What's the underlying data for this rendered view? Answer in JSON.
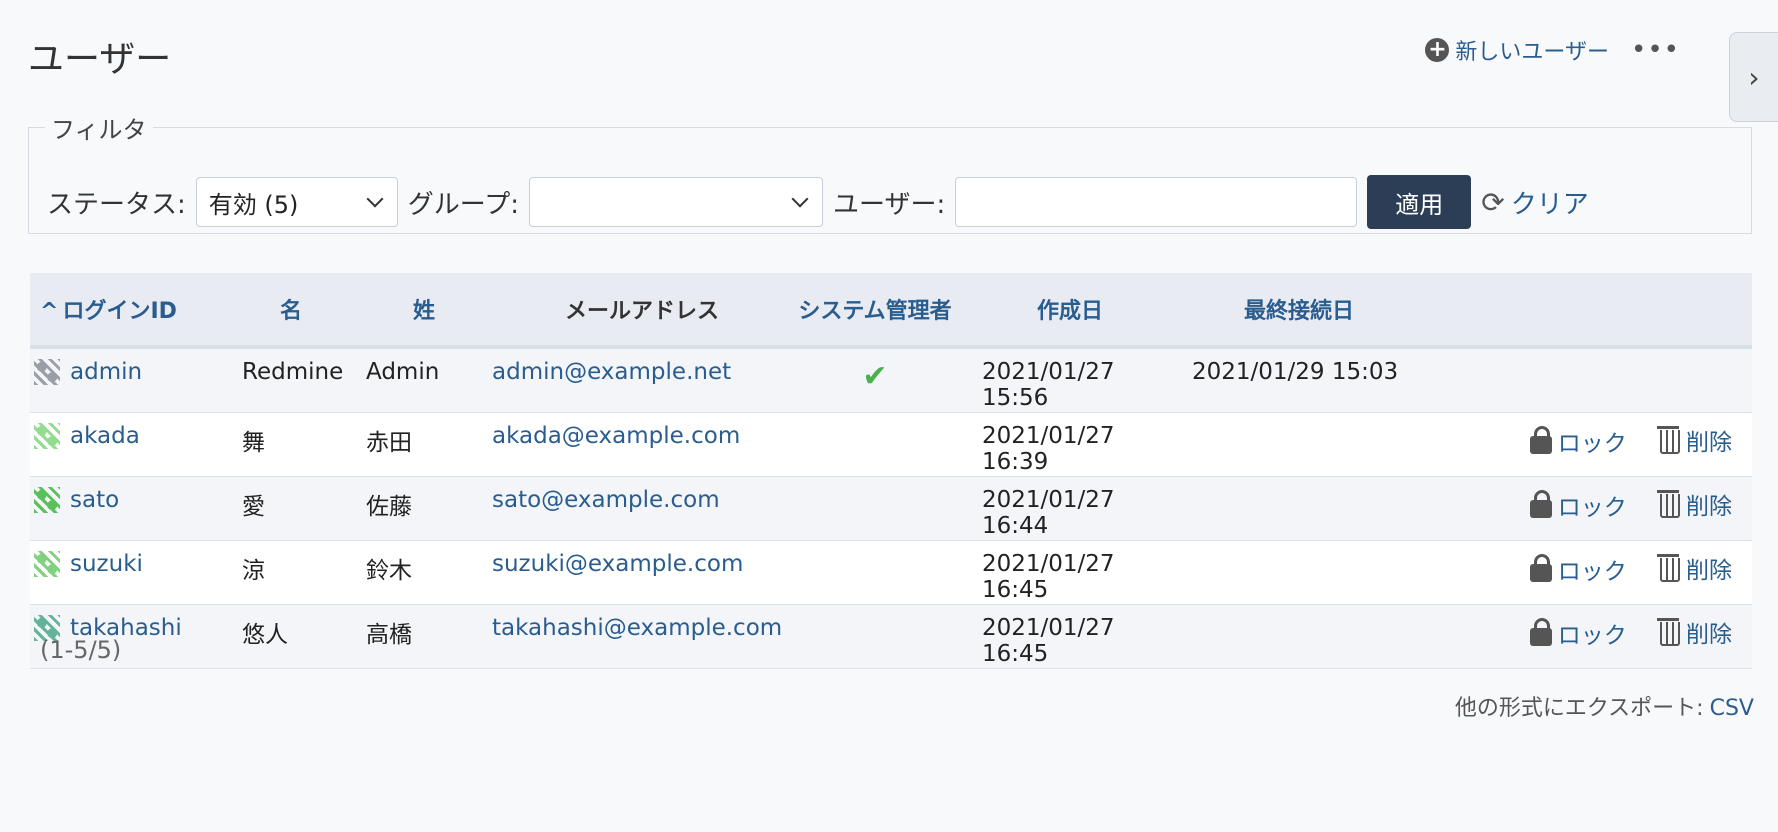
{
  "page": {
    "title": "ユーザー"
  },
  "contextual": {
    "new_user": "新しいユーザー",
    "more": "•••"
  },
  "filters": {
    "legend": "フィルタ",
    "status_label": "ステータス:",
    "status_value": "有効 (5)",
    "group_label": "グループ:",
    "group_value": "",
    "user_label": "ユーザー:",
    "user_value": "",
    "apply": "適用",
    "clear": "クリア"
  },
  "table": {
    "sort_indicator": "^",
    "headers": {
      "login": "ログインID",
      "firstname": "名",
      "lastname": "姓",
      "mail": "メールアドレス",
      "admin": "システム管理者",
      "created": "作成日",
      "last_login": "最終接続日"
    },
    "rows": [
      {
        "login": "admin",
        "firstname": "Redmine",
        "lastname": "Admin",
        "mail": "admin@example.net",
        "admin": "✔",
        "created": "2021/01/27 15:56",
        "last_login": "2021/01/29 15:03",
        "lock": "",
        "delete": "",
        "avatar_color": "#8a8f99"
      },
      {
        "login": "akada",
        "firstname": "舞",
        "lastname": "赤田",
        "mail": "akada@example.com",
        "admin": "",
        "created": "2021/01/27 16:39",
        "last_login": "",
        "lock": "ロック",
        "delete": "削除",
        "avatar_color": "#7ed67e"
      },
      {
        "login": "sato",
        "firstname": "愛",
        "lastname": "佐藤",
        "mail": "sato@example.com",
        "admin": "",
        "created": "2021/01/27 16:44",
        "last_login": "",
        "lock": "ロック",
        "delete": "削除",
        "avatar_color": "#3fb83f"
      },
      {
        "login": "suzuki",
        "firstname": "涼",
        "lastname": "鈴木",
        "mail": "suzuki@example.com",
        "admin": "",
        "created": "2021/01/27 16:45",
        "last_login": "",
        "lock": "ロック",
        "delete": "削除",
        "avatar_color": "#6cc96c"
      },
      {
        "login": "takahashi",
        "firstname": "悠人",
        "lastname": "高橋",
        "mail": "takahashi@example.com",
        "admin": "",
        "created": "2021/01/27 16:45",
        "last_login": "",
        "lock": "ロック",
        "delete": "削除",
        "avatar_color": "#4aa88a"
      }
    ]
  },
  "pagination": "(1-5/5)",
  "export": {
    "label": "他の形式にエクスポート:",
    "csv": "CSV"
  },
  "colors": {
    "link": "#2a5d8f",
    "button": "#2c3e56",
    "header_bg": "#e8ecf2",
    "check": "#4caf50"
  }
}
